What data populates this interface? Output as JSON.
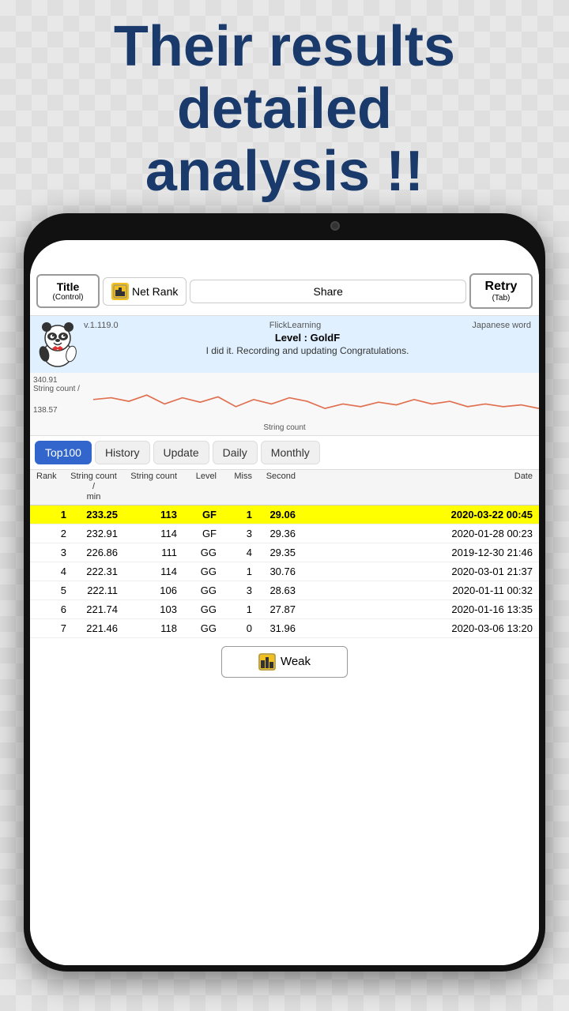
{
  "header": {
    "line1": "Their results",
    "line2": "detailed",
    "line3": "analysis !!"
  },
  "toolbar": {
    "title_label": "Title",
    "title_sub": "(Control)",
    "netrank_label": "Net Rank",
    "share_label": "Share",
    "retry_label": "Retry",
    "retry_sub": "(Tab)"
  },
  "info": {
    "version": "v.1.119.0",
    "app_name": "FlickLearning",
    "level": "Level : GoldF",
    "message": "I did it. Recording and updating Congratulations.",
    "subject": "Japanese word"
  },
  "chart": {
    "y_top": "340.91",
    "y_label": "String count /",
    "y_bottom": "138.57",
    "x_label": "String count"
  },
  "tabs": [
    {
      "label": "Top100",
      "active": true
    },
    {
      "label": "History",
      "active": false
    },
    {
      "label": "Update",
      "active": false
    },
    {
      "label": "Daily",
      "active": false
    },
    {
      "label": "Monthly",
      "active": false
    }
  ],
  "table": {
    "headers": {
      "rank": "Rank",
      "string_count_min": "String count / min",
      "string_count": "String count",
      "level": "Level",
      "miss": "Miss",
      "second": "Second",
      "date": "Date"
    },
    "rows": [
      {
        "rank": "1",
        "string_count_min": "233.25",
        "string_count": "113",
        "level": "GF",
        "miss": "1",
        "second": "29.06",
        "date": "2020-03-22 00:45",
        "highlight": true
      },
      {
        "rank": "2",
        "string_count_min": "232.91",
        "string_count": "114",
        "level": "GF",
        "miss": "3",
        "second": "29.36",
        "date": "2020-01-28 00:23",
        "highlight": false
      },
      {
        "rank": "3",
        "string_count_min": "226.86",
        "string_count": "111",
        "level": "GG",
        "miss": "4",
        "second": "29.35",
        "date": "2019-12-30 21:46",
        "highlight": false
      },
      {
        "rank": "4",
        "string_count_min": "222.31",
        "string_count": "114",
        "level": "GG",
        "miss": "1",
        "second": "30.76",
        "date": "2020-03-01 21:37",
        "highlight": false
      },
      {
        "rank": "5",
        "string_count_min": "222.11",
        "string_count": "106",
        "level": "GG",
        "miss": "3",
        "second": "28.63",
        "date": "2020-01-11 00:32",
        "highlight": false
      },
      {
        "rank": "6",
        "string_count_min": "221.74",
        "string_count": "103",
        "level": "GG",
        "miss": "1",
        "second": "27.87",
        "date": "2020-01-16 13:35",
        "highlight": false
      },
      {
        "rank": "7",
        "string_count_min": "221.46",
        "string_count": "118",
        "level": "GG",
        "miss": "0",
        "second": "31.96",
        "date": "2020-03-06 13:20",
        "highlight": false
      }
    ]
  },
  "weak_button": "Weak",
  "colors": {
    "accent_blue": "#1a3a6b",
    "tab_active": "#3366cc",
    "highlight_yellow": "#ffff00",
    "chart_line": "#e07050"
  }
}
